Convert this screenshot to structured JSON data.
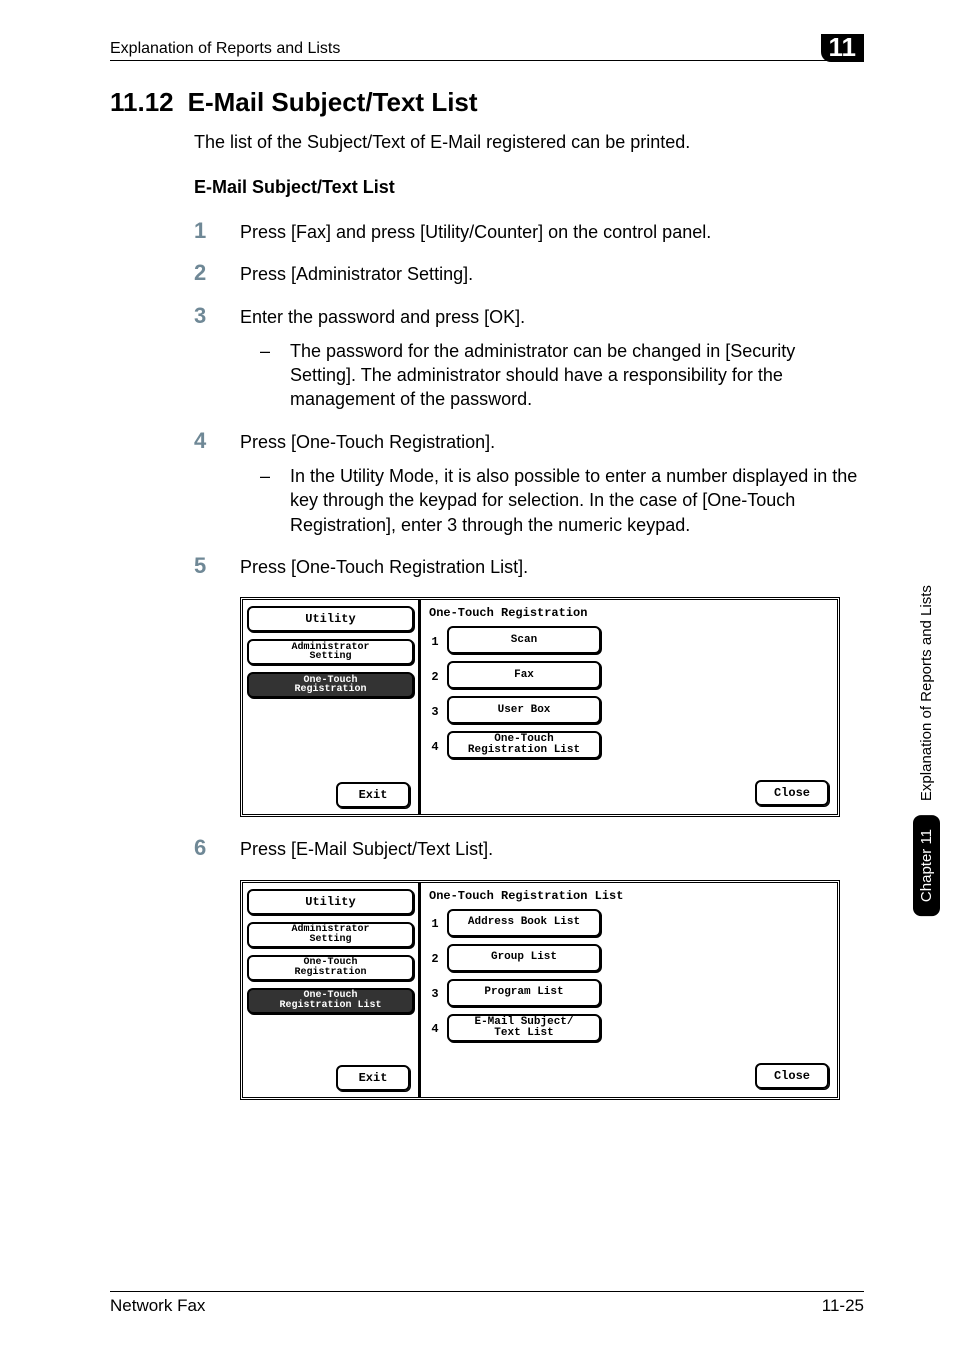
{
  "header": {
    "running_title": "Explanation of Reports and Lists",
    "chapter_badge": "11"
  },
  "section": {
    "number": "11.12",
    "title": "E-Mail Subject/Text List",
    "intro": "The list of the Subject/Text of E-Mail registered can be printed.",
    "sub_heading": "E-Mail Subject/Text List"
  },
  "steps": [
    {
      "num": "1",
      "text": "Press [Fax] and press [Utility/Counter] on the control panel."
    },
    {
      "num": "2",
      "text": "Press [Administrator Setting]."
    },
    {
      "num": "3",
      "text": "Enter the password and press [OK].",
      "note": "The password for the administrator can be changed in [Security Setting]. The administrator should have a responsibility for the management of the password."
    },
    {
      "num": "4",
      "text": "Press [One-Touch Registration].",
      "note": "In the Utility Mode, it is also possible to enter a number displayed in the key through the keypad for selection. In the case of [One-Touch Registration], enter 3 through the numeric keypad."
    },
    {
      "num": "5",
      "text": "Press [One-Touch Registration List]."
    },
    {
      "num": "6",
      "text": "Press [E-Mail Subject/Text List]."
    }
  ],
  "screenshot1": {
    "left": {
      "top": "Utility",
      "middle1": "Administrator\nSetting",
      "middle2": "One-Touch\nRegistration",
      "exit": "Exit"
    },
    "right": {
      "title": "One-Touch Registration",
      "items": [
        {
          "n": "1",
          "label": "Scan"
        },
        {
          "n": "2",
          "label": "Fax"
        },
        {
          "n": "3",
          "label": "User Box"
        },
        {
          "n": "4",
          "label": "One-Touch\nRegistration List"
        }
      ],
      "close": "Close"
    }
  },
  "screenshot2": {
    "left": {
      "top": "Utility",
      "middle1": "Administrator\nSetting",
      "middle2": "One-Touch\nRegistration",
      "middle3": "One-Touch\nRegistration List",
      "exit": "Exit"
    },
    "right": {
      "title": "One-Touch Registration List",
      "items": [
        {
          "n": "1",
          "label": "Address Book List"
        },
        {
          "n": "2",
          "label": "Group List"
        },
        {
          "n": "3",
          "label": "Program List"
        },
        {
          "n": "4",
          "label": "E-Mail Subject/\nText List"
        }
      ],
      "close": "Close"
    }
  },
  "side": {
    "chapter": "Chapter 11",
    "title": "Explanation of Reports and Lists"
  },
  "footer": {
    "left": "Network Fax",
    "right": "11-25"
  }
}
